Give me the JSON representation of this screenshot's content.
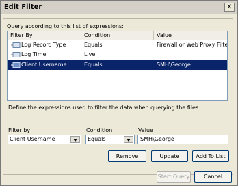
{
  "dialog": {
    "title": "Edit Filter",
    "close_glyph": "✕"
  },
  "query_group": {
    "label": "Query according to this list of expressions:"
  },
  "list": {
    "columns": [
      "Filter By",
      "Condition",
      "Value"
    ],
    "rows": [
      {
        "filter_by": "Log Record Type",
        "condition": "Equals",
        "value": "Firewall or Web Proxy Filter",
        "selected": false
      },
      {
        "filter_by": "Log Time",
        "condition": "Live",
        "value": "",
        "selected": false
      },
      {
        "filter_by": "Client Username",
        "condition": "Equals",
        "value": "SMH\\George",
        "selected": true
      }
    ]
  },
  "instructions": "Define the expressions used to filter the data when querying the files:",
  "form": {
    "filter_by_label": "Filter by",
    "condition_label": "Condition",
    "value_label": "Value",
    "filter_by_value": "Client Username",
    "condition_value": "Equals",
    "value_value": "SMH\\George"
  },
  "buttons": {
    "remove": "Remove",
    "update": "Update",
    "add_to_list": "Add To List",
    "start_query": "Start Query",
    "cancel": "Cancel"
  },
  "colors": {
    "selection": "#0A246A",
    "window_bg": "#ECE9D8"
  }
}
